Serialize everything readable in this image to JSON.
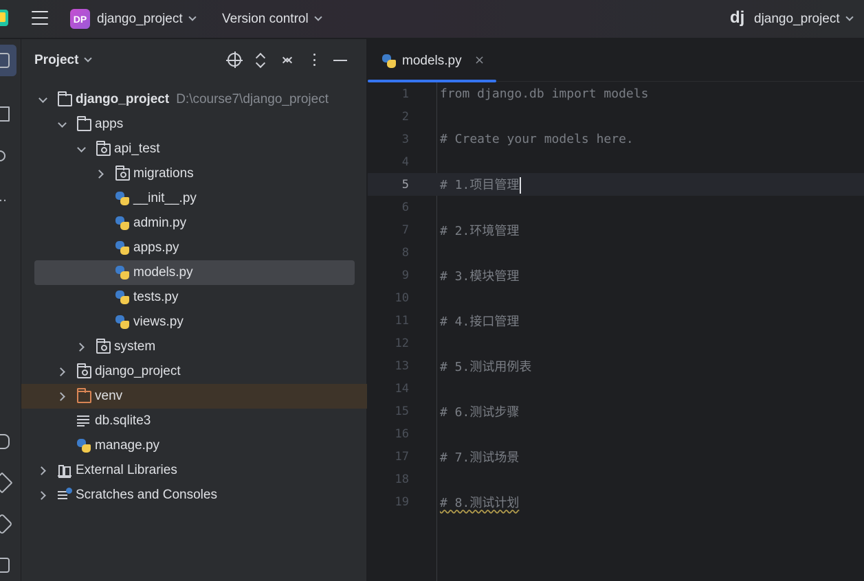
{
  "titlebar": {
    "badge": "DP",
    "project": "django_project",
    "vcs": "Version control",
    "framework_logo": "dj",
    "run_config": "django_project"
  },
  "project_panel": {
    "title": "Project",
    "tree": [
      {
        "label": "django_project",
        "path": "D:\\course7\\django_project",
        "icon": "folder-icon",
        "expand": "down",
        "level": 0,
        "bold": true
      },
      {
        "label": "apps",
        "icon": "folder-icon",
        "expand": "down",
        "level": 1
      },
      {
        "label": "api_test",
        "icon": "package-folder-icon",
        "expand": "down",
        "level": 2
      },
      {
        "label": "migrations",
        "icon": "package-folder-icon",
        "expand": "right",
        "level": 3
      },
      {
        "label": "__init__.py",
        "icon": "python-file-icon",
        "level": 3
      },
      {
        "label": "admin.py",
        "icon": "python-file-icon",
        "level": 3
      },
      {
        "label": "apps.py",
        "icon": "python-file-icon",
        "level": 3
      },
      {
        "label": "models.py",
        "icon": "python-file-icon",
        "level": 3,
        "selected": true
      },
      {
        "label": "tests.py",
        "icon": "python-file-icon",
        "level": 3
      },
      {
        "label": "views.py",
        "icon": "python-file-icon",
        "level": 3
      },
      {
        "label": "system",
        "icon": "package-folder-icon",
        "expand": "right",
        "level": 2
      },
      {
        "label": "django_project",
        "icon": "package-folder-icon",
        "expand": "right",
        "level": 1
      },
      {
        "label": "venv",
        "icon": "excluded-folder-icon",
        "expand": "right",
        "level": 1,
        "venv": true
      },
      {
        "label": "db.sqlite3",
        "icon": "text-file-icon",
        "level": 1
      },
      {
        "label": "manage.py",
        "icon": "python-file-icon",
        "level": 1
      },
      {
        "label": "External Libraries",
        "icon": "library-icon",
        "expand": "right",
        "level": 0
      },
      {
        "label": "Scratches and Consoles",
        "icon": "scratches-icon",
        "expand": "right",
        "level": 0
      }
    ]
  },
  "editor": {
    "tab": {
      "label": "models.py",
      "close": "×"
    },
    "current_line": 5,
    "lines": [
      {
        "n": "1",
        "text": "from django.db import models"
      },
      {
        "n": "2",
        "text": ""
      },
      {
        "n": "3",
        "text": "# Create your models here."
      },
      {
        "n": "4",
        "text": ""
      },
      {
        "n": "5",
        "text": "# 1.项目管理"
      },
      {
        "n": "6",
        "text": ""
      },
      {
        "n": "7",
        "text": "# 2.环境管理"
      },
      {
        "n": "8",
        "text": ""
      },
      {
        "n": "9",
        "text": "# 3.模块管理"
      },
      {
        "n": "10",
        "text": ""
      },
      {
        "n": "11",
        "text": "# 4.接口管理"
      },
      {
        "n": "12",
        "text": ""
      },
      {
        "n": "13",
        "text": "# 5.测试用例表"
      },
      {
        "n": "14",
        "text": ""
      },
      {
        "n": "15",
        "text": "# 6.测试步骤"
      },
      {
        "n": "16",
        "text": ""
      },
      {
        "n": "17",
        "text": "# 7.测试场景"
      },
      {
        "n": "18",
        "text": ""
      },
      {
        "n": "19",
        "text": "# 8.测试计划"
      }
    ]
  },
  "colors": {
    "accent": "#3574f0",
    "selection": "#43454a",
    "venv_row": "#3e3429",
    "comment": "#7a7e85"
  }
}
